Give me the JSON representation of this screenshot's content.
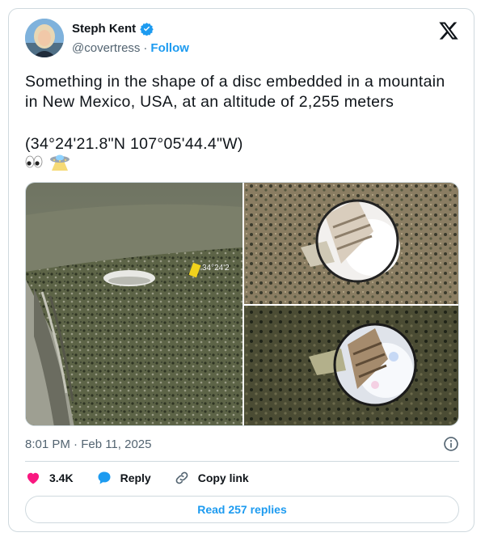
{
  "author": {
    "name": "Steph Kent",
    "handle": "@covertress",
    "separator": "·",
    "follow_label": "Follow"
  },
  "tweet": {
    "text": "Something in the shape of a disc embedded in a mountain\nin New Mexico, USA, at an altitude of 2,255 meters",
    "coordinates": "(34°24'21.8\"N 107°05'44.4\"W)",
    "emojis": [
      "eyes-emoji",
      "ufo-emoji"
    ]
  },
  "media": {
    "overlay_label": "34°24'2"
  },
  "meta": {
    "timestamp": "8:01 PM · Feb 11, 2025"
  },
  "actions": {
    "likes": "3.4K",
    "reply_label": "Reply",
    "copy_link_label": "Copy link"
  },
  "read_replies_label": "Read 257 replies",
  "colors": {
    "accent": "#1d9bf0",
    "like": "#f91880",
    "text": "#0f1419",
    "muted": "#536471",
    "border": "#cfd9de"
  }
}
